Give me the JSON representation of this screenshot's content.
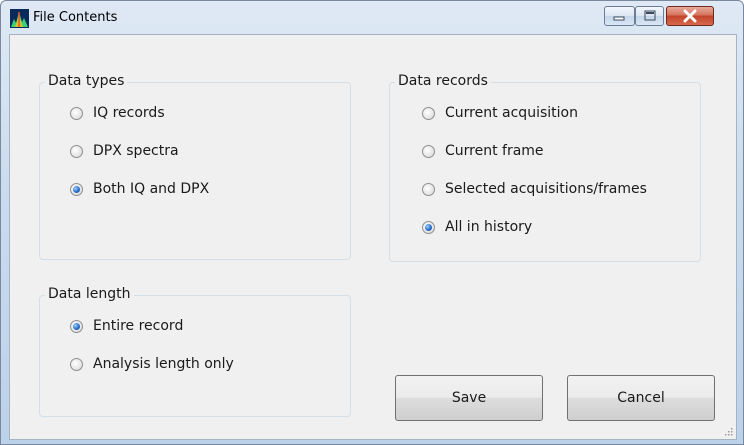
{
  "window": {
    "title": "File Contents",
    "icon": "spectrum-app-icon"
  },
  "data_types": {
    "label": "Data types",
    "options": [
      {
        "label": "IQ records",
        "checked": false
      },
      {
        "label": "DPX spectra",
        "checked": false
      },
      {
        "label": "Both IQ and DPX",
        "checked": true
      }
    ]
  },
  "data_records": {
    "label": "Data records",
    "options": [
      {
        "label": "Current acquisition",
        "checked": false
      },
      {
        "label": "Current frame",
        "checked": false
      },
      {
        "label": "Selected acquisitions/frames",
        "checked": false
      },
      {
        "label": "All in history",
        "checked": true
      }
    ]
  },
  "data_length": {
    "label": "Data length",
    "options": [
      {
        "label": "Entire record",
        "checked": true
      },
      {
        "label": "Analysis length only",
        "checked": false
      }
    ]
  },
  "buttons": {
    "save": "Save",
    "cancel": "Cancel"
  }
}
